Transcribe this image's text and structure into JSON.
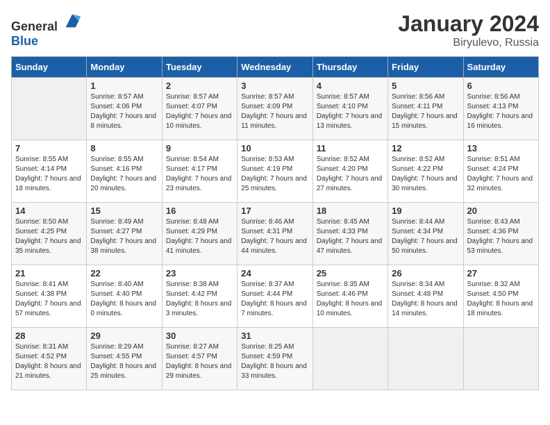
{
  "logo": {
    "text_general": "General",
    "text_blue": "Blue"
  },
  "title": "January 2024",
  "subtitle": "Biryulevo, Russia",
  "days_of_week": [
    "Sunday",
    "Monday",
    "Tuesday",
    "Wednesday",
    "Thursday",
    "Friday",
    "Saturday"
  ],
  "weeks": [
    [
      {
        "day": "",
        "sunrise": "",
        "sunset": "",
        "daylight": ""
      },
      {
        "day": "1",
        "sunrise": "Sunrise: 8:57 AM",
        "sunset": "Sunset: 4:06 PM",
        "daylight": "Daylight: 7 hours and 8 minutes."
      },
      {
        "day": "2",
        "sunrise": "Sunrise: 8:57 AM",
        "sunset": "Sunset: 4:07 PM",
        "daylight": "Daylight: 7 hours and 10 minutes."
      },
      {
        "day": "3",
        "sunrise": "Sunrise: 8:57 AM",
        "sunset": "Sunset: 4:09 PM",
        "daylight": "Daylight: 7 hours and 11 minutes."
      },
      {
        "day": "4",
        "sunrise": "Sunrise: 8:57 AM",
        "sunset": "Sunset: 4:10 PM",
        "daylight": "Daylight: 7 hours and 13 minutes."
      },
      {
        "day": "5",
        "sunrise": "Sunrise: 8:56 AM",
        "sunset": "Sunset: 4:11 PM",
        "daylight": "Daylight: 7 hours and 15 minutes."
      },
      {
        "day": "6",
        "sunrise": "Sunrise: 8:56 AM",
        "sunset": "Sunset: 4:13 PM",
        "daylight": "Daylight: 7 hours and 16 minutes."
      }
    ],
    [
      {
        "day": "7",
        "sunrise": "Sunrise: 8:55 AM",
        "sunset": "Sunset: 4:14 PM",
        "daylight": "Daylight: 7 hours and 18 minutes."
      },
      {
        "day": "8",
        "sunrise": "Sunrise: 8:55 AM",
        "sunset": "Sunset: 4:16 PM",
        "daylight": "Daylight: 7 hours and 20 minutes."
      },
      {
        "day": "9",
        "sunrise": "Sunrise: 8:54 AM",
        "sunset": "Sunset: 4:17 PM",
        "daylight": "Daylight: 7 hours and 23 minutes."
      },
      {
        "day": "10",
        "sunrise": "Sunrise: 8:53 AM",
        "sunset": "Sunset: 4:19 PM",
        "daylight": "Daylight: 7 hours and 25 minutes."
      },
      {
        "day": "11",
        "sunrise": "Sunrise: 8:52 AM",
        "sunset": "Sunset: 4:20 PM",
        "daylight": "Daylight: 7 hours and 27 minutes."
      },
      {
        "day": "12",
        "sunrise": "Sunrise: 8:52 AM",
        "sunset": "Sunset: 4:22 PM",
        "daylight": "Daylight: 7 hours and 30 minutes."
      },
      {
        "day": "13",
        "sunrise": "Sunrise: 8:51 AM",
        "sunset": "Sunset: 4:24 PM",
        "daylight": "Daylight: 7 hours and 32 minutes."
      }
    ],
    [
      {
        "day": "14",
        "sunrise": "Sunrise: 8:50 AM",
        "sunset": "Sunset: 4:25 PM",
        "daylight": "Daylight: 7 hours and 35 minutes."
      },
      {
        "day": "15",
        "sunrise": "Sunrise: 8:49 AM",
        "sunset": "Sunset: 4:27 PM",
        "daylight": "Daylight: 7 hours and 38 minutes."
      },
      {
        "day": "16",
        "sunrise": "Sunrise: 8:48 AM",
        "sunset": "Sunset: 4:29 PM",
        "daylight": "Daylight: 7 hours and 41 minutes."
      },
      {
        "day": "17",
        "sunrise": "Sunrise: 8:46 AM",
        "sunset": "Sunset: 4:31 PM",
        "daylight": "Daylight: 7 hours and 44 minutes."
      },
      {
        "day": "18",
        "sunrise": "Sunrise: 8:45 AM",
        "sunset": "Sunset: 4:33 PM",
        "daylight": "Daylight: 7 hours and 47 minutes."
      },
      {
        "day": "19",
        "sunrise": "Sunrise: 8:44 AM",
        "sunset": "Sunset: 4:34 PM",
        "daylight": "Daylight: 7 hours and 50 minutes."
      },
      {
        "day": "20",
        "sunrise": "Sunrise: 8:43 AM",
        "sunset": "Sunset: 4:36 PM",
        "daylight": "Daylight: 7 hours and 53 minutes."
      }
    ],
    [
      {
        "day": "21",
        "sunrise": "Sunrise: 8:41 AM",
        "sunset": "Sunset: 4:38 PM",
        "daylight": "Daylight: 7 hours and 57 minutes."
      },
      {
        "day": "22",
        "sunrise": "Sunrise: 8:40 AM",
        "sunset": "Sunset: 4:40 PM",
        "daylight": "Daylight: 8 hours and 0 minutes."
      },
      {
        "day": "23",
        "sunrise": "Sunrise: 8:38 AM",
        "sunset": "Sunset: 4:42 PM",
        "daylight": "Daylight: 8 hours and 3 minutes."
      },
      {
        "day": "24",
        "sunrise": "Sunrise: 8:37 AM",
        "sunset": "Sunset: 4:44 PM",
        "daylight": "Daylight: 8 hours and 7 minutes."
      },
      {
        "day": "25",
        "sunrise": "Sunrise: 8:35 AM",
        "sunset": "Sunset: 4:46 PM",
        "daylight": "Daylight: 8 hours and 10 minutes."
      },
      {
        "day": "26",
        "sunrise": "Sunrise: 8:34 AM",
        "sunset": "Sunset: 4:48 PM",
        "daylight": "Daylight: 8 hours and 14 minutes."
      },
      {
        "day": "27",
        "sunrise": "Sunrise: 8:32 AM",
        "sunset": "Sunset: 4:50 PM",
        "daylight": "Daylight: 8 hours and 18 minutes."
      }
    ],
    [
      {
        "day": "28",
        "sunrise": "Sunrise: 8:31 AM",
        "sunset": "Sunset: 4:52 PM",
        "daylight": "Daylight: 8 hours and 21 minutes."
      },
      {
        "day": "29",
        "sunrise": "Sunrise: 8:29 AM",
        "sunset": "Sunset: 4:55 PM",
        "daylight": "Daylight: 8 hours and 25 minutes."
      },
      {
        "day": "30",
        "sunrise": "Sunrise: 8:27 AM",
        "sunset": "Sunset: 4:57 PM",
        "daylight": "Daylight: 8 hours and 29 minutes."
      },
      {
        "day": "31",
        "sunrise": "Sunrise: 8:25 AM",
        "sunset": "Sunset: 4:59 PM",
        "daylight": "Daylight: 8 hours and 33 minutes."
      },
      {
        "day": "",
        "sunrise": "",
        "sunset": "",
        "daylight": ""
      },
      {
        "day": "",
        "sunrise": "",
        "sunset": "",
        "daylight": ""
      },
      {
        "day": "",
        "sunrise": "",
        "sunset": "",
        "daylight": ""
      }
    ]
  ]
}
